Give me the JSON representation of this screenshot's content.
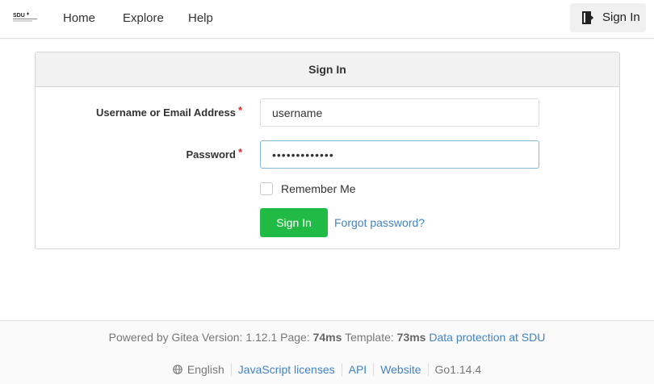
{
  "navbar": {
    "logo_text": "SDU",
    "links": [
      "Home",
      "Explore",
      "Help"
    ],
    "signin_label": "Sign In"
  },
  "form": {
    "title": "Sign In",
    "username_label": "Username or Email Address",
    "username_value": "username",
    "password_label": "Password",
    "password_value": "•••••••••••••",
    "required_mark": "*",
    "remember_label": "Remember Me",
    "remember_checked": false,
    "submit_label": "Sign In",
    "forgot_label": "Forgot password?"
  },
  "footer": {
    "powered_prefix": "Powered by Gitea Version: 1.12.1 Page:",
    "page_time": "74ms",
    "template_prefix": "Template:",
    "template_time": "73ms",
    "data_protection": "Data protection at SDU",
    "language": "English",
    "links": [
      "JavaScript licenses",
      "API",
      "Website"
    ],
    "go_version": "Go1.14.4"
  },
  "colors": {
    "accent_green": "#21ba45",
    "link_blue": "#4183c4",
    "required_red": "#db2828"
  },
  "icons": [
    "sdu-logo-icon",
    "sign-in-icon",
    "globe-icon"
  ]
}
